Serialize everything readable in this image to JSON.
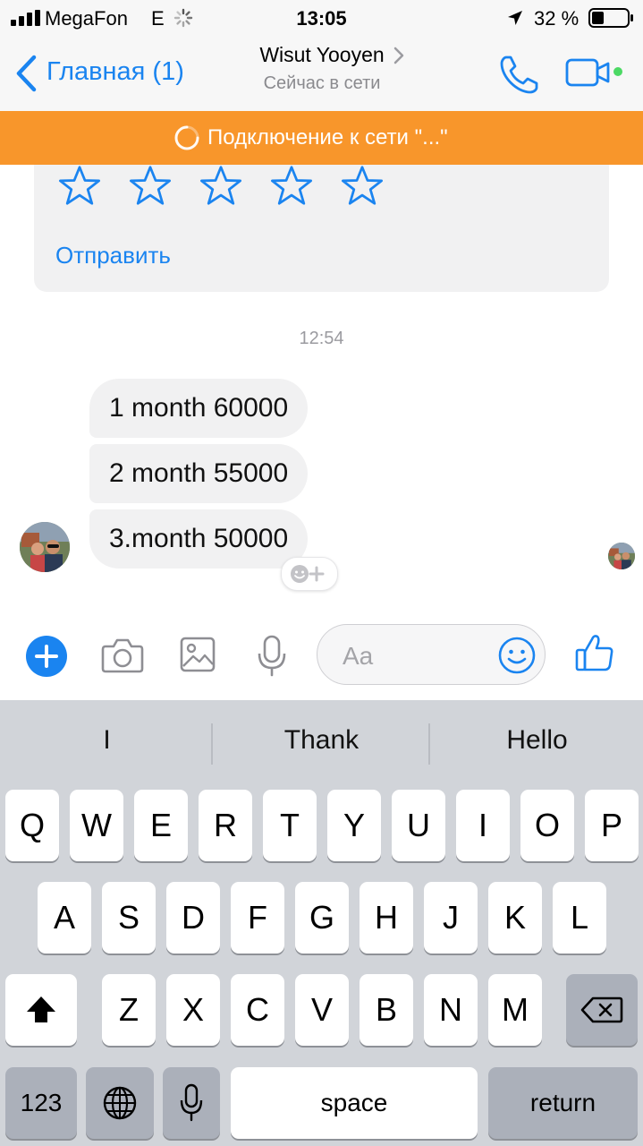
{
  "status_bar": {
    "carrier": "MegaFon",
    "network": "E",
    "time": "13:05",
    "battery": "32 %"
  },
  "nav": {
    "back_label": "Главная (1)",
    "contact_name": "Wisut Yooyen",
    "contact_status": "Сейчас в сети",
    "call_icon": "phone-icon",
    "video_icon": "video-camera-icon",
    "online_color": "#4cd964"
  },
  "banner": {
    "text": "Подключение к сети \"...\"",
    "color": "#f8962b"
  },
  "rating": {
    "stars": 5,
    "send_label": "Отправить"
  },
  "chat": {
    "timestamp": "12:54",
    "messages": [
      {
        "text": "1 month 60000"
      },
      {
        "text": "2 month 55000"
      },
      {
        "text": "3.month 50000"
      }
    ]
  },
  "composer": {
    "placeholder": "Aa",
    "accent_color": "#1a84f0"
  },
  "keyboard": {
    "suggestions": [
      "I",
      "Thank",
      "Hello"
    ],
    "row1": [
      "Q",
      "W",
      "E",
      "R",
      "T",
      "Y",
      "U",
      "I",
      "O",
      "P"
    ],
    "row2": [
      "A",
      "S",
      "D",
      "F",
      "G",
      "H",
      "J",
      "K",
      "L"
    ],
    "row3": [
      "Z",
      "X",
      "C",
      "V",
      "B",
      "N",
      "M"
    ],
    "numbers_label": "123",
    "space_label": "space",
    "return_label": "return"
  }
}
